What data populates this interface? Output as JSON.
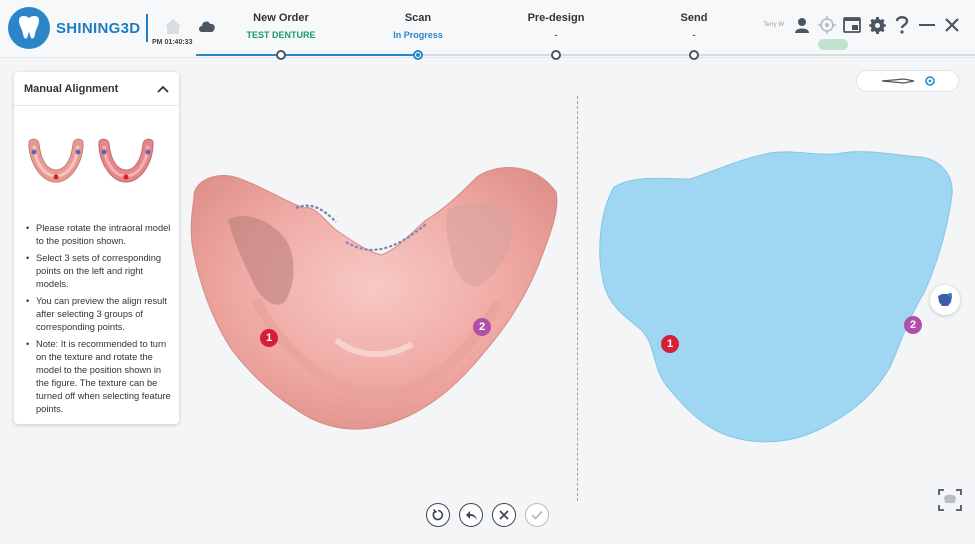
{
  "app": {
    "brand": "SHINING3D",
    "clock": "PM 01:40:33"
  },
  "steps": [
    {
      "title": "New Order",
      "sub": "TEST DENTURE",
      "color": "#1b9a6a"
    },
    {
      "title": "Scan",
      "sub": "In Progress",
      "color": "#2a86c8"
    },
    {
      "title": "Pre-design",
      "sub": "-",
      "color": "#555555"
    },
    {
      "title": "Send",
      "sub": "-",
      "color": "#555555"
    }
  ],
  "user": {
    "name": "Terry W"
  },
  "panel": {
    "title": "Manual Alignment",
    "instructions": [
      "Please rotate the intraoral model to the position shown.",
      "Select 3 sets of corresponding points on the left and right models.",
      "You can preview the align result after selecting 3 groups of corresponding points.",
      "Note: It is recommended to turn on the texture and rotate the model to the position shown in the figure. The texture can be turned off when selecting feature points."
    ]
  },
  "markers": {
    "one": "1",
    "two": "2"
  },
  "colors": {
    "accent": "#2a86c8",
    "brand": "#1f7dc2",
    "scan_pink": "#f0a8a4",
    "model_blue": "#9fd6f2",
    "marker_red": "#d61f37",
    "marker_purple": "#b24fa8"
  },
  "icons": [
    "home-icon",
    "cloud-icon",
    "user-icon",
    "target-icon",
    "screen-icon",
    "gear-icon",
    "help-icon",
    "minimize-icon",
    "close-icon",
    "collapse-icon",
    "reset-view-icon",
    "undo-icon",
    "clear-icon",
    "confirm-icon",
    "texture-icon",
    "fit-view-icon"
  ]
}
